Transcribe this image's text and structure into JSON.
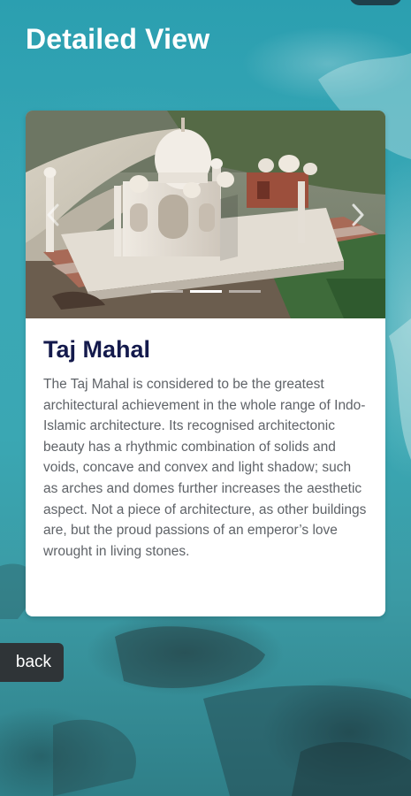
{
  "header": {
    "title": "Detailed View"
  },
  "card": {
    "title": "Taj Mahal",
    "description": "The Taj Mahal is considered to be the greatest architectural achievement in the whole range of Indo-Islamic architecture. Its recognised architectonic beauty has a rhythmic combination of solids and voids, concave and convex and light shadow; such as arches and domes further increases the aesthetic aspect. Not a piece of architecture, as other buildings are, but the proud passions of an emperor’s love wrought in living stones.",
    "carousel": {
      "slide_count": 3,
      "active_slide": 2,
      "image_alt": "Taj Mahal aerial view"
    }
  },
  "actions": {
    "back_label": "back"
  },
  "colors": {
    "title_dark_navy": "#141a4c",
    "body_text_gray": "#5f6368",
    "back_button_bg": "#2f3437",
    "ocean_teal": "#3aa8b6"
  },
  "icons": {
    "prev": "chevron-left-icon",
    "next": "chevron-right-icon"
  }
}
